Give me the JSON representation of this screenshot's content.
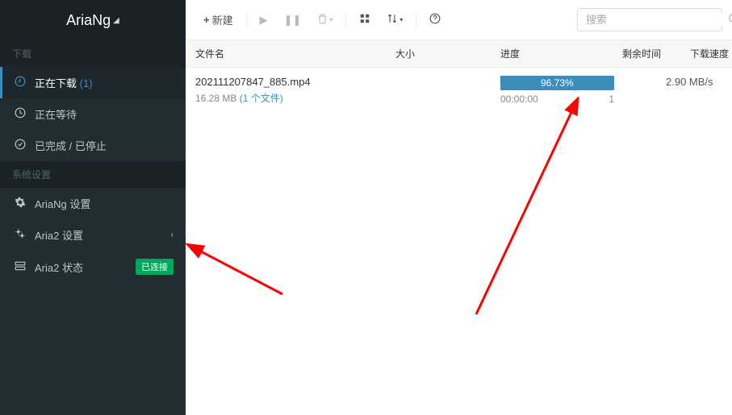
{
  "brand": {
    "name": "AriaNg"
  },
  "sidebar": {
    "section_downloads": "下载",
    "section_settings": "系统设置",
    "items": {
      "downloading": {
        "label": "正在下载",
        "count": "(1)"
      },
      "waiting": {
        "label": "正在等待"
      },
      "stopped": {
        "label": "已完成 / 已停止"
      },
      "ariang_settings": {
        "label": "AriaNg 设置"
      },
      "aria2_settings": {
        "label": "Aria2 设置"
      },
      "aria2_status": {
        "label": "Aria2 状态",
        "badge": "已连接"
      }
    }
  },
  "toolbar": {
    "new_label": "新建",
    "search_placeholder": "搜索"
  },
  "table": {
    "headers": {
      "name": "文件名",
      "size": "大小",
      "progress": "进度",
      "remain": "剩余时间",
      "speed": "下载速度"
    },
    "rows": [
      {
        "filename": "202111207847_885.mp4",
        "size": "16.28 MB",
        "file_count_label": "(1 个文件)",
        "progress_percent": "96.73%",
        "eta": "00:00:00",
        "connections": "1",
        "speed": "2.90 MB/s"
      }
    ]
  }
}
